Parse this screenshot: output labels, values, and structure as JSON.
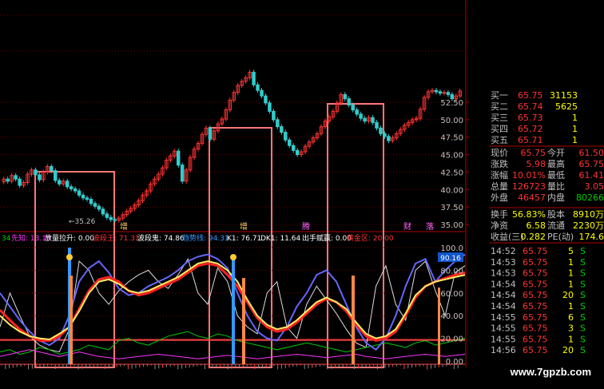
{
  "colors": {
    "bg": "#000000",
    "up": "#ff3333",
    "down": "#33cccc",
    "grid": "#7a0000",
    "axis": "#b00000",
    "label_gray": "#c0c0c0",
    "white": "#ffffff",
    "yellow": "#ffff00",
    "green": "#00cc00",
    "blue": "#3399ff",
    "magenta": "#ff33ff",
    "orange": "#ff8800"
  },
  "price_chart": {
    "y_labels": [
      "52.50",
      "50.00",
      "47.50",
      "45.00",
      "42.50",
      "40.00",
      "37.50",
      "35.00"
    ],
    "low_label": "35.26",
    "low_marker": "←35.26",
    "event_labels": [
      {
        "text": "增",
        "color": "#ffcc66"
      },
      {
        "text": "增",
        "color": "#ffcc66"
      },
      {
        "text": "腾",
        "color": "#ff66ff"
      },
      {
        "text": "财",
        "color": "#ff66ff"
      },
      {
        "text": "落",
        "color": "#ff66ff"
      }
    ]
  },
  "indicator_header": {
    "items": [
      {
        "text": "34",
        "color": "#00cc00"
      },
      {
        "text": "先知: 13.19",
        "color": "#ff33ff"
      },
      {
        "text": "放量拉升: 0.00",
        "color": "#ffffff"
      },
      {
        "text": "波段王: 71.31",
        "color": "#ff3333"
      },
      {
        "text": "波段鬼: 74.86",
        "color": "#ffffff"
      },
      {
        "text": "趋势线: 94.31",
        "color": "#3399ff"
      },
      {
        "text": "K1: 76.71",
        "color": "#ffffff"
      },
      {
        "text": "DK1: 11.64",
        "color": "#ffffff"
      },
      {
        "text": "出手赋赢: 0.00",
        "color": "#ffffff"
      },
      {
        "text": "黄金区: 20.00",
        "color": "#ff3333"
      }
    ]
  },
  "indicator_axis": {
    "labels": [
      "100.0",
      "80.00",
      "60.00",
      "40.00",
      "20.00",
      "0.00"
    ],
    "current_value": "90.16"
  },
  "quote_panel": {
    "book": [
      {
        "label": "买一",
        "price": "65.75",
        "vol": "31153"
      },
      {
        "label": "买二",
        "price": "65.74",
        "vol": "5625"
      },
      {
        "label": "买三",
        "price": "65.73",
        "vol": "1"
      },
      {
        "label": "买四",
        "price": "65.72",
        "vol": "1"
      },
      {
        "label": "买五",
        "price": "65.71",
        "vol": "1"
      }
    ],
    "stats": [
      {
        "l1": "现价",
        "v1": "65.75",
        "l2": "今开",
        "v2": "61.50"
      },
      {
        "l1": "涨跌",
        "v1": "5.98",
        "l2": "最高",
        "v2": "65.75"
      },
      {
        "l1": "涨幅",
        "v1": "10.01%",
        "l2": "最低",
        "v2": "61.41"
      },
      {
        "l1": "总量",
        "v1": "126723",
        "l2": "量比",
        "v2": "3.05"
      },
      {
        "l1": "外盘",
        "v1": "46457",
        "l2": "内盘",
        "v2": "80266"
      }
    ],
    "stats2": [
      {
        "l1": "换手",
        "v1": "56.83%",
        "l2": "股本",
        "v2": "8910万"
      },
      {
        "l1": "净资",
        "v1": "6.58",
        "l2": "流通",
        "v2": "2230万"
      },
      {
        "l1": "收益(三)",
        "v1": "0.282",
        "l2": "PE(动)",
        "v2": "174.6"
      }
    ],
    "ticks": [
      {
        "time": "14:52",
        "price": "65.75",
        "vol": "5",
        "side": "S"
      },
      {
        "time": "14:53",
        "price": "65.75",
        "vol": "1",
        "side": "S"
      },
      {
        "time": "14:53",
        "price": "65.75",
        "vol": "1",
        "side": "S"
      },
      {
        "time": "14:54",
        "price": "65.75",
        "vol": "1",
        "side": "S"
      },
      {
        "time": "14:54",
        "price": "65.75",
        "vol": "20",
        "side": "S"
      },
      {
        "time": "14:54",
        "price": "65.75",
        "vol": "1",
        "side": "S"
      },
      {
        "time": "14:55",
        "price": "65.75",
        "vol": "6",
        "side": "S"
      },
      {
        "time": "14:55",
        "price": "65.75",
        "vol": "3",
        "side": "S"
      },
      {
        "time": "14:55",
        "price": "65.75",
        "vol": "1",
        "side": "S"
      },
      {
        "time": "14:56",
        "price": "65.75",
        "vol": "20",
        "side": "S"
      }
    ]
  },
  "watermark": "www.7gpzb.com"
}
